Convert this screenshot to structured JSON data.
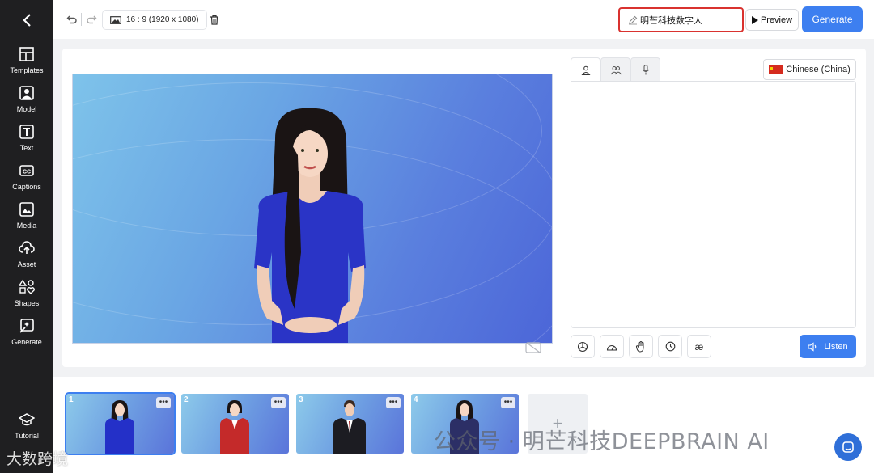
{
  "sidebar": {
    "items": [
      {
        "label": "Templates",
        "icon": "templates-icon"
      },
      {
        "label": "Model",
        "icon": "model-icon"
      },
      {
        "label": "Text",
        "icon": "text-icon"
      },
      {
        "label": "Captions",
        "icon": "captions-icon"
      },
      {
        "label": "Media",
        "icon": "media-icon"
      },
      {
        "label": "Asset",
        "icon": "asset-icon"
      },
      {
        "label": "Shapes",
        "icon": "shapes-icon"
      },
      {
        "label": "Generate",
        "icon": "generate-icon"
      }
    ],
    "tutorial_label": "Tutorial"
  },
  "toolbar": {
    "aspect_label": "16 : 9 (1920 x 1080)",
    "project_name": "明芒科技数字人",
    "preview_label": "Preview",
    "generate_label": "Generate"
  },
  "editor": {
    "language_label": "Chinese (China)",
    "listen_label": "Listen",
    "tools": [
      "openai-icon",
      "speed-icon",
      "gesture-icon",
      "timer-icon",
      "æ"
    ]
  },
  "scenes": [
    {
      "number": "1",
      "more": "•••",
      "outfit": "#2430c8"
    },
    {
      "number": "2",
      "more": "•••",
      "outfit": "#c42a2a"
    },
    {
      "number": "3",
      "more": "•••",
      "outfit": "#1c1c22"
    },
    {
      "number": "4",
      "more": "•••",
      "outfit": "#2c2f66"
    }
  ],
  "watermark": {
    "text": "公众号 · 明芒科技DEEPBRAIN AI",
    "brand": "大数跨境"
  },
  "colors": {
    "accent": "#3d7ff0",
    "sidebar_bg": "#1f1f21",
    "highlight": "#d9322f"
  }
}
